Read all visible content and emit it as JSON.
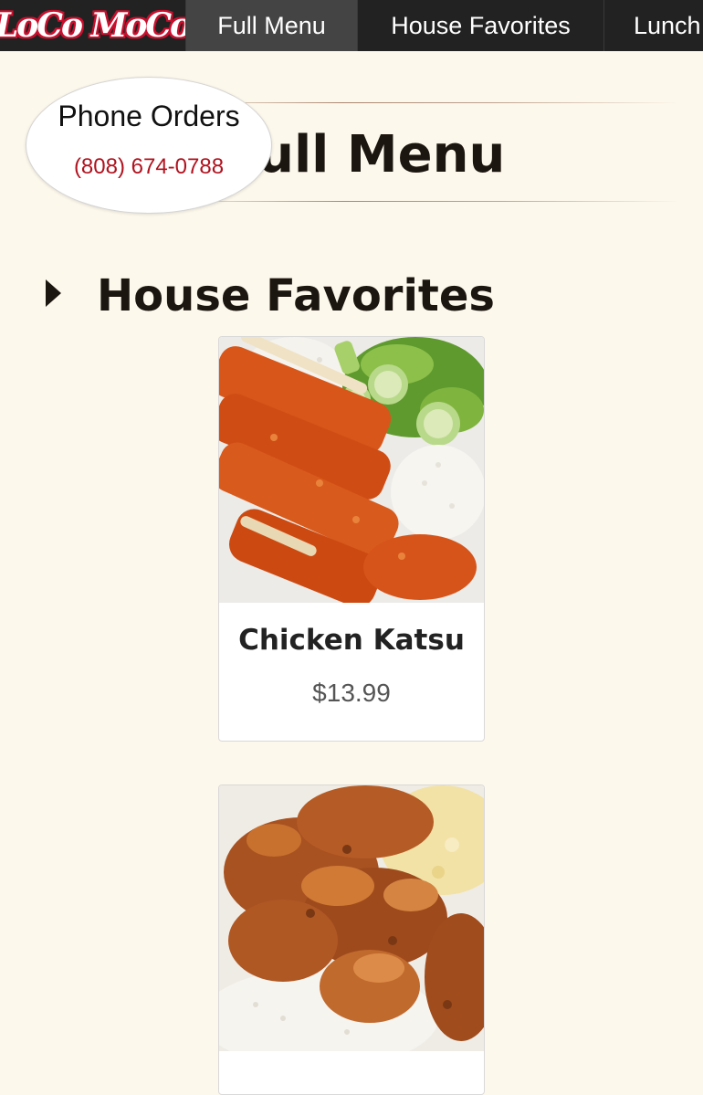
{
  "brand": {
    "logo_text": "LoCo MoCo",
    "logo_red": "#c8102e"
  },
  "nav": {
    "tabs": [
      {
        "label": "Full Menu",
        "active": true
      },
      {
        "label": "House Favorites",
        "active": false
      },
      {
        "label": "Lunch",
        "active": false
      }
    ]
  },
  "phone_orders": {
    "label": "Phone Orders",
    "number": "(808) 674-0788",
    "number_color": "#b0121e"
  },
  "page": {
    "title": "Full Menu"
  },
  "sections": [
    {
      "title": "House Favorites",
      "toggle_icon": "caret-right-icon",
      "items": [
        {
          "name": "Chicken Katsu",
          "price": "$13.99",
          "photo": "chicken-katsu-plate-photo"
        },
        {
          "photo": "fried-chicken-plate-photo"
        }
      ]
    }
  ],
  "colors": {
    "nav_background": "#222222",
    "nav_active": "#444444",
    "page_background": "#fdf8ec",
    "heading": "#1c1610"
  }
}
